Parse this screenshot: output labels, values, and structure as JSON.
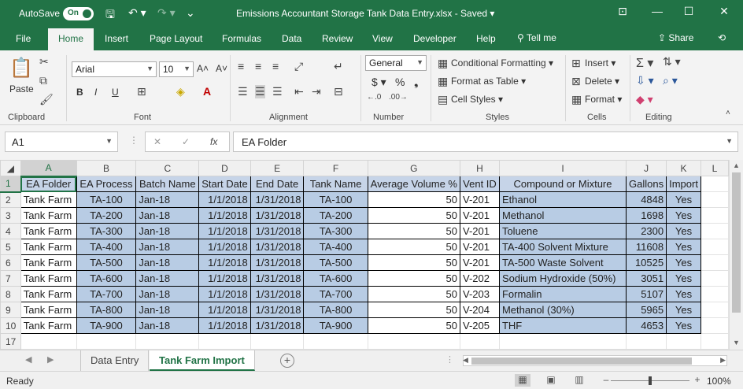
{
  "titlebar": {
    "autosave_label": "AutoSave",
    "autosave_state": "On",
    "doc_title": "Emissions Accountant Storage Tank Data Entry.xlsx  -  Saved  ▾",
    "qat": {
      "save": "🖫",
      "undo": "↶ ▾",
      "redo": "↷ ▾",
      "more": "⌄"
    },
    "win": {
      "ribbon": "⊡",
      "minimize": "—",
      "restore": "☐",
      "close": "✕"
    }
  },
  "tabs": [
    "File",
    "Home",
    "Insert",
    "Page Layout",
    "Formulas",
    "Data",
    "Review",
    "View",
    "Developer",
    "Help"
  ],
  "active_tab": "Home",
  "tell_me": "Tell me",
  "share": "Share",
  "ribbon": {
    "clipboard": {
      "label": "Clipboard",
      "paste": "Paste"
    },
    "font": {
      "label": "Font",
      "family": "Arial",
      "size": "10",
      "bold": "B",
      "italic": "I",
      "underline": "U",
      "grow": "A˄",
      "shrink": "A˅"
    },
    "alignment": {
      "label": "Alignment"
    },
    "number": {
      "label": "Number",
      "format": "General",
      "currency": "$ ▾",
      "percent": "%",
      "comma": "❟"
    },
    "styles": {
      "label": "Styles",
      "conditional": "Conditional Formatting ▾",
      "format_table": "Format as Table ▾",
      "cell_styles": "Cell Styles ▾"
    },
    "cells": {
      "label": "Cells",
      "insert": "Insert ▾",
      "delete": "Delete ▾",
      "format": "Format ▾"
    },
    "editing": {
      "label": "Editing"
    }
  },
  "formula_bar": {
    "name_box": "A1",
    "formula": "EA Folder",
    "cancel": "✕",
    "enter": "✓",
    "fx": "fx"
  },
  "columns": [
    "A",
    "B",
    "C",
    "D",
    "E",
    "F",
    "G",
    "H",
    "I",
    "J",
    "K",
    "L"
  ],
  "headers": [
    "EA Folder",
    "EA Process",
    "Batch Name",
    "Start Date",
    "End Date",
    "Tank Name",
    "Average Volume %",
    "Vent ID",
    "Compound or Mixture",
    "Gallons",
    "Import"
  ],
  "rows": [
    {
      "num": "2",
      "cells": [
        "Tank Farm",
        "TA-100",
        "Jan-18",
        "1/1/2018",
        "1/31/2018",
        "TA-100",
        "50",
        "V-201",
        "Ethanol",
        "4848",
        "Yes"
      ]
    },
    {
      "num": "3",
      "cells": [
        "Tank Farm",
        "TA-200",
        "Jan-18",
        "1/1/2018",
        "1/31/2018",
        "TA-200",
        "50",
        "V-201",
        "Methanol",
        "1698",
        "Yes"
      ]
    },
    {
      "num": "4",
      "cells": [
        "Tank Farm",
        "TA-300",
        "Jan-18",
        "1/1/2018",
        "1/31/2018",
        "TA-300",
        "50",
        "V-201",
        "Toluene",
        "2300",
        "Yes"
      ]
    },
    {
      "num": "5",
      "cells": [
        "Tank Farm",
        "TA-400",
        "Jan-18",
        "1/1/2018",
        "1/31/2018",
        "TA-400",
        "50",
        "V-201",
        "TA-400 Solvent Mixture",
        "11608",
        "Yes"
      ]
    },
    {
      "num": "6",
      "cells": [
        "Tank Farm",
        "TA-500",
        "Jan-18",
        "1/1/2018",
        "1/31/2018",
        "TA-500",
        "50",
        "V-201",
        "TA-500 Waste Solvent",
        "10525",
        "Yes"
      ]
    },
    {
      "num": "7",
      "cells": [
        "Tank Farm",
        "TA-600",
        "Jan-18",
        "1/1/2018",
        "1/31/2018",
        "TA-600",
        "50",
        "V-202",
        "Sodium Hydroxide (50%)",
        "3051",
        "Yes"
      ]
    },
    {
      "num": "8",
      "cells": [
        "Tank Farm",
        "TA-700",
        "Jan-18",
        "1/1/2018",
        "1/31/2018",
        "TA-700",
        "50",
        "V-203",
        "Formalin",
        "5107",
        "Yes"
      ]
    },
    {
      "num": "9",
      "cells": [
        "Tank Farm",
        "TA-800",
        "Jan-18",
        "1/1/2018",
        "1/31/2018",
        "TA-800",
        "50",
        "V-204",
        "Methanol (30%)",
        "5965",
        "Yes"
      ]
    },
    {
      "num": "10",
      "cells": [
        "Tank Farm",
        "TA-900",
        "Jan-18",
        "1/1/2018",
        "1/31/2018",
        "TA-900",
        "50",
        "V-205",
        "THF",
        "4653",
        "Yes"
      ]
    }
  ],
  "header_row_num": "1",
  "tail_row_num": "17",
  "sheets": [
    "Data Entry",
    "Tank Farm Import"
  ],
  "active_sheet": "Tank Farm Import",
  "status": {
    "ready": "Ready",
    "zoom": "100%",
    "zoom_minus": "–",
    "zoom_plus": "+"
  }
}
